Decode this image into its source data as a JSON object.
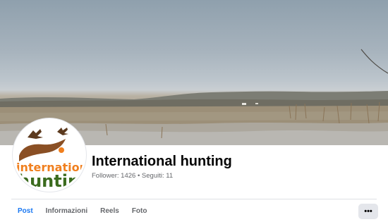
{
  "page": {
    "name": "International hunting",
    "stats": "Follower: 1426 • Seguiti: 11"
  },
  "profile_picture": {
    "logo_text_line1": "international",
    "logo_text_line2": "hunting"
  },
  "tabs": [
    {
      "label": "Post",
      "active": true
    },
    {
      "label": "Informazioni",
      "active": false
    },
    {
      "label": "Reels",
      "active": false
    },
    {
      "label": "Foto",
      "active": false
    }
  ],
  "more_button": {
    "label": "•••",
    "icon": "more-horizontal-icon"
  },
  "colors": {
    "accent": "#1877f2",
    "logo_orange": "#f07f1e",
    "logo_brown": "#8a4f24",
    "logo_green": "#3b6b1e"
  }
}
